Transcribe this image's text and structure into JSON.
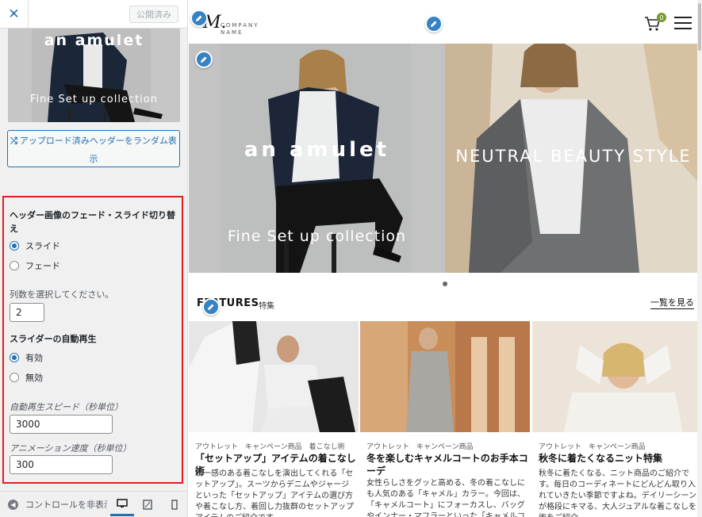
{
  "sidebar": {
    "close_glyph": "✕",
    "publish_label": "公開済み",
    "thumb": {
      "title": "an amulet",
      "subtitle": "Fine Set up collection"
    },
    "random_button_label": "アップロード済みヘッダーをランダム表示",
    "random_icon": "shuffle-icon",
    "fade_slide_label": "ヘッダー画像のフェード・スライド切り替え",
    "fade_options": [
      {
        "label": "スライド",
        "checked": true
      },
      {
        "label": "フェード",
        "checked": false
      }
    ],
    "columns_label": "列数を選択してください。",
    "columns_value": "2",
    "autoplay_label": "スライダーの自動再生",
    "autoplay_options": [
      {
        "label": "有効",
        "checked": true
      },
      {
        "label": "無効",
        "checked": false
      }
    ],
    "speed_label": "自動再生スピード（秒単位）",
    "speed_value": "3000",
    "anim_label": "アニメーション速度（秒単位）",
    "anim_value": "300",
    "hide_controls_label": "コントロールを非表示",
    "devices": [
      "desktop-icon",
      "tablet-icon",
      "mobile-icon"
    ],
    "accent_color": "#2271b1",
    "highlight_color": "#e11d1d"
  },
  "preview": {
    "logo": {
      "mark": "M.",
      "line1": "COMPANY",
      "line2": "NAME"
    },
    "cart_count": "0",
    "hero": {
      "left_title": "an amulet",
      "left_subtitle": "Fine Set up collection",
      "right_title": "NEUTRAL BEAUTY STYLE"
    },
    "features": {
      "title": "FEATURES",
      "subtitle": "特集",
      "see_all": "一覧を見る"
    },
    "cards": [
      {
        "tags": [
          "アウトレット",
          "キャンペーン商品",
          "着こなし術"
        ],
        "title": "「セットアップ」アイテムの着こなし術",
        "excerpt": "統一感のある着こなしを演出してくれる「セットアップ」。スーツからデニムやジャージといった「セットアップ」アイテムの選び方や着こなし方、着回し力抜群のセットアップアイテムのご紹介です。"
      },
      {
        "tags": [
          "アウトレット",
          "キャンペーン商品"
        ],
        "title": "冬を楽しむキャメルコートのお手本コーデ",
        "excerpt": "女性らしさをグッと高める、冬の着こなしにも人気のある「キャメル」カラー。今回は、「キャメルコート」にフォーカスし、バッグやインナー・マフラーといった「キャメルコート」に"
      },
      {
        "tags": [
          "アウトレット",
          "キャンペーン商品"
        ],
        "title": "秋冬に着たくなるニット特集",
        "excerpt": "秋冬に着たくなる、ニット商品のご紹介です。毎日のコーディネートにどんどん取り入れていきたい季節ですよね。デイリーシーンが格段にキマる、大人ジュアルな着こなしを術をご紹介。"
      }
    ]
  }
}
